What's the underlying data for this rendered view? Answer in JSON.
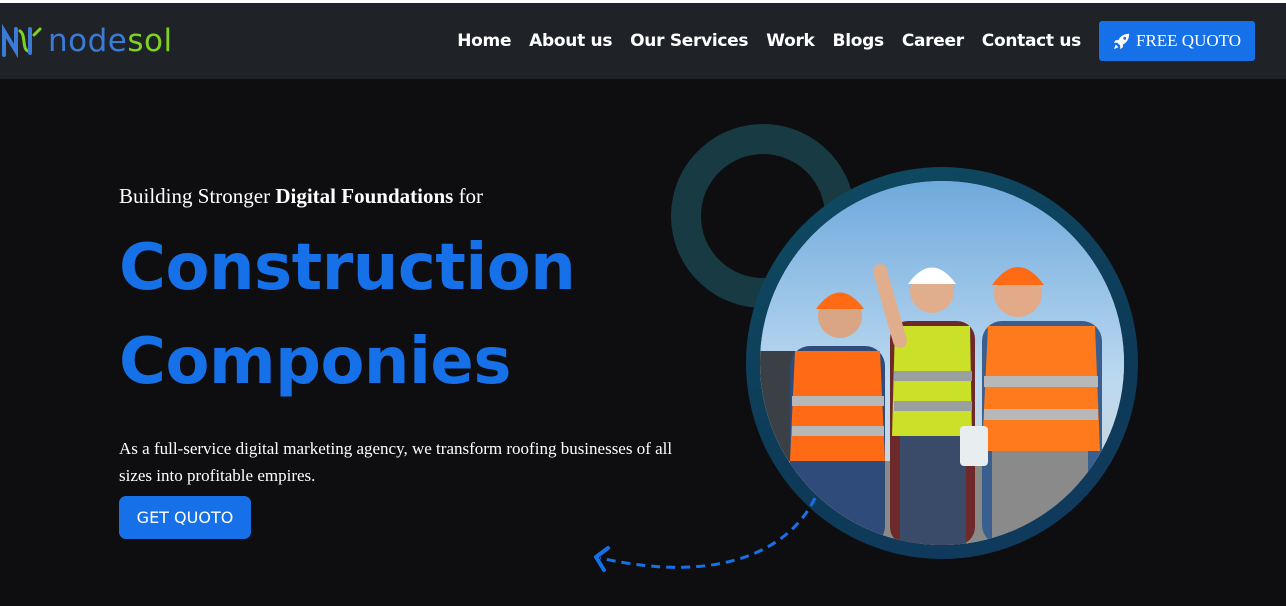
{
  "brand": {
    "name_part1": "node",
    "name_part2": "sol",
    "primary": "#3a7bd5",
    "accent": "#7ed321"
  },
  "nav": {
    "links": [
      "Home",
      "About us",
      "Our Services",
      "Work",
      "Blogs",
      "Career",
      "Contact us"
    ],
    "cta_label": "FREE QUOTO",
    "cta_icon": "rocket-icon"
  },
  "hero": {
    "kicker_pre": "Building Stronger ",
    "kicker_bold": "Digital Foundations",
    "kicker_post": " for",
    "headline_line1": "Construction",
    "headline_line2": "Componies",
    "description": "As a full-service digital marketing agency, we transform roofing businesses of all sizes into profitable empires.",
    "button_label": "GET QUOTO"
  },
  "colors": {
    "accent_blue": "#1670e8",
    "background": "#0e0e10",
    "navbar": "#1f2226"
  }
}
